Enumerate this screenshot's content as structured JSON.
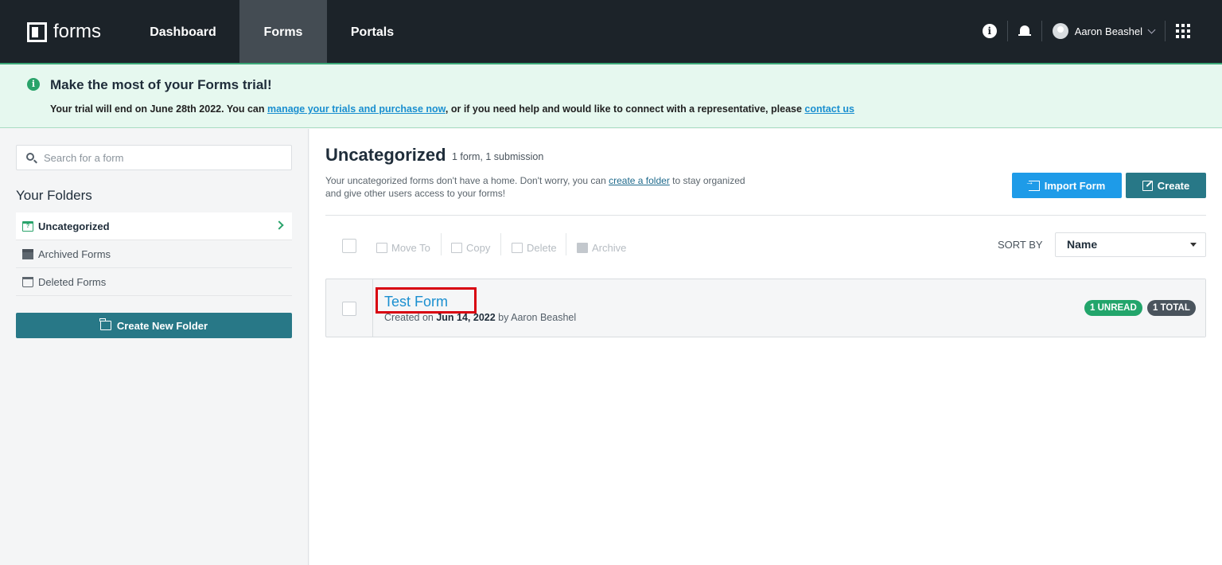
{
  "nav": {
    "logo_text": "forms",
    "items": [
      {
        "label": "Dashboard",
        "active": false
      },
      {
        "label": "Forms",
        "active": true
      },
      {
        "label": "Portals",
        "active": false
      }
    ],
    "user_name": "Aaron Beashel"
  },
  "banner": {
    "title": "Make the most of your Forms trial!",
    "text_1": "Your trial will end on June 28th 2022. You can ",
    "link_1": "manage your trials and purchase now",
    "text_2": ", or if you need help and would like to connect with a representative, please ",
    "link_2": "contact us"
  },
  "sidebar": {
    "search_placeholder": "Search for a form",
    "folders_title": "Your Folders",
    "items": [
      {
        "label": "Uncategorized",
        "active": true
      },
      {
        "label": "Archived Forms",
        "active": false
      },
      {
        "label": "Deleted Forms",
        "active": false
      }
    ],
    "new_folder_label": "Create New Folder"
  },
  "main": {
    "title": "Uncategorized",
    "subtitle": "1 form, 1 submission",
    "desc_1": "Your uncategorized forms don't have a home. Don't worry, you can ",
    "desc_link": "create a folder",
    "desc_2": " to stay organized and give other users access to your forms!",
    "import_label": "Import Form",
    "create_label": "Create",
    "toolbar": {
      "move_label": "Move To",
      "copy_label": "Copy",
      "delete_label": "Delete",
      "archive_label": "Archive"
    },
    "sort_label": "SORT BY",
    "sort_value": "Name",
    "forms": [
      {
        "name": "Test Form",
        "created_prefix": "Created on ",
        "created_date": "Jun 14, 2022",
        "created_suffix": " by Aaron Beashel",
        "unread_badge": "1 UNREAD",
        "total_badge": "1 TOTAL"
      }
    ]
  },
  "colors": {
    "nav_bg": "#1c2329",
    "accent_green": "#22a56b",
    "teal_button": "#287887",
    "blue_button": "#1e9be8",
    "link_blue": "#1a8fd0",
    "highlight_red": "#d80010"
  }
}
